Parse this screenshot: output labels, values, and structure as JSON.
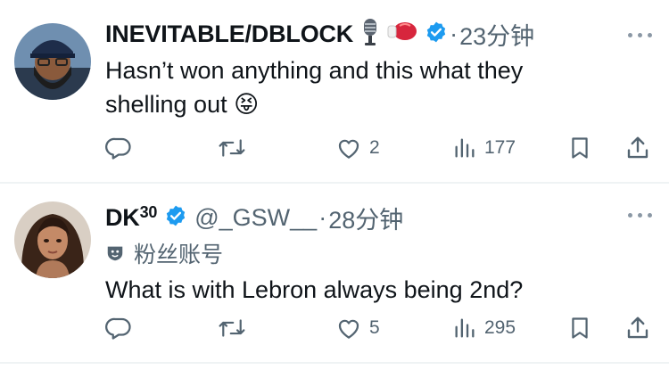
{
  "tweets": [
    {
      "display_name": "INEVITABLE/DBLOCK",
      "name_emojis": [
        "microphone-emoji",
        "boxing-glove-emoji"
      ],
      "verified": true,
      "separator": "·",
      "time": "23分钟",
      "text": "Hasn’t won anything and this what they shelling out",
      "text_emoji": "😝",
      "reply_count": "",
      "retweet_count": "",
      "like_count": "2",
      "view_count": "177"
    },
    {
      "display_name": "DK",
      "display_name_sup": "30",
      "verified": true,
      "handle": "@_GSW__",
      "separator": "·",
      "time": "28分钟",
      "label": "粉丝账号",
      "text": "What is with Lebron always being 2nd?",
      "reply_count": "",
      "retweet_count": "",
      "like_count": "5",
      "view_count": "295"
    }
  ],
  "colors": {
    "verified_blue": "#1d9bf0",
    "text_primary": "#0f1419",
    "text_secondary": "#536471",
    "divider": "#eff3f4"
  },
  "icons": [
    "reply-icon",
    "retweet-icon",
    "like-icon",
    "views-icon",
    "bookmark-icon",
    "share-icon",
    "more-icon",
    "verified-badge-icon",
    "fan-account-icon"
  ]
}
